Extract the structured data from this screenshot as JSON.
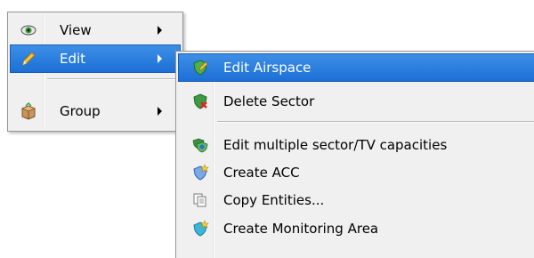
{
  "main_menu": {
    "items": [
      {
        "label": "View",
        "icon": "eye-icon",
        "has_submenu": true
      },
      {
        "label": "Edit",
        "icon": "pencil-icon",
        "has_submenu": true,
        "highlighted": true
      },
      {
        "label": "Group",
        "icon": "package-icon",
        "has_submenu": true
      }
    ]
  },
  "edit_submenu": {
    "items": [
      {
        "label": "Edit Airspace",
        "icon": "shield-pencil-icon",
        "highlighted": true
      },
      {
        "label": "Delete Sector",
        "icon": "shield-delete-icon"
      },
      {
        "label": "Edit multiple sector/TV capacities",
        "icon": "multiple-sectors-icon"
      },
      {
        "label": "Create ACC",
        "icon": "create-acc-icon"
      },
      {
        "label": "Copy Entities...",
        "icon": "copy-icon"
      },
      {
        "label": "Create Monitoring Area",
        "icon": "create-monitoring-area-icon"
      }
    ]
  },
  "colors": {
    "menu_background": "#f0f0f0",
    "highlight": "#2a7ae2",
    "highlight_text": "#ffffff"
  }
}
